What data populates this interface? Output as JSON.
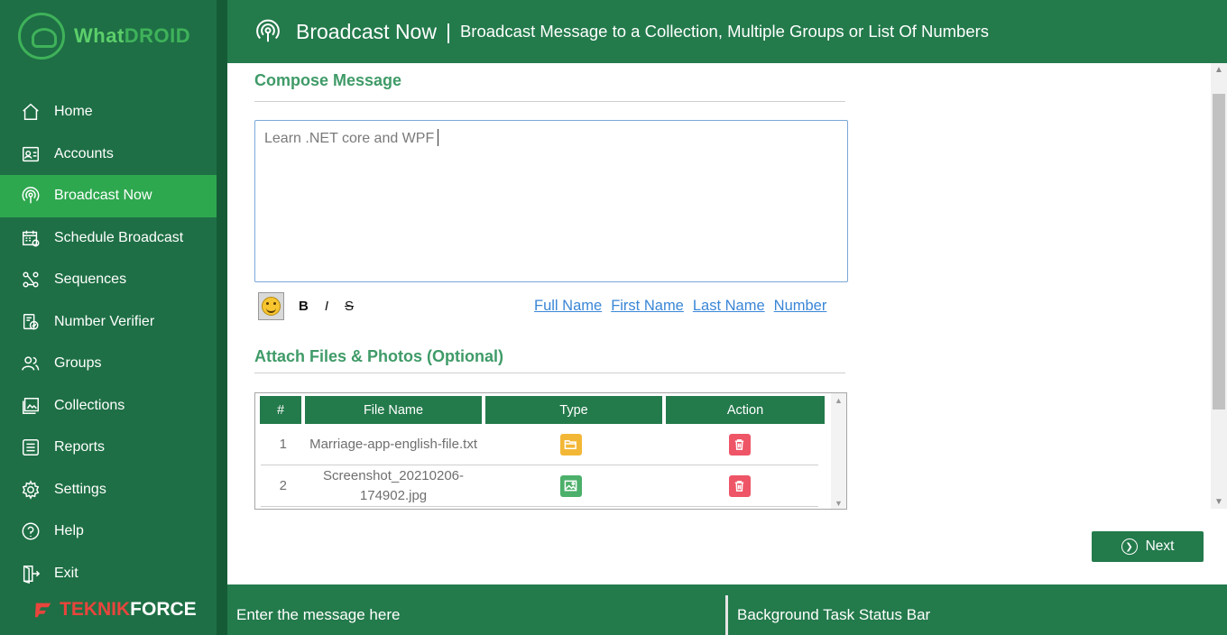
{
  "app": {
    "logo": {
      "part1": "What",
      "part2": "DROID"
    },
    "brand": {
      "part1": "TEKNIK",
      "part2": "FORCE"
    }
  },
  "sidebar": {
    "items": [
      {
        "label": "Home",
        "icon": "home-icon"
      },
      {
        "label": "Accounts",
        "icon": "accounts-icon"
      },
      {
        "label": "Broadcast Now",
        "icon": "broadcast-icon",
        "active": true
      },
      {
        "label": "Schedule Broadcast",
        "icon": "calendar-icon"
      },
      {
        "label": "Sequences",
        "icon": "sequences-icon"
      },
      {
        "label": "Number Verifier",
        "icon": "verifier-icon"
      },
      {
        "label": "Groups",
        "icon": "groups-icon"
      },
      {
        "label": "Collections",
        "icon": "collections-icon"
      },
      {
        "label": "Reports",
        "icon": "reports-icon"
      },
      {
        "label": "Settings",
        "icon": "gear-icon"
      },
      {
        "label": "Help",
        "icon": "help-icon"
      },
      {
        "label": "Exit",
        "icon": "exit-icon"
      }
    ]
  },
  "header": {
    "title": "Broadcast Now",
    "separator": "|",
    "subtitle": "Broadcast Message to a Collection, Multiple Groups or List Of Numbers"
  },
  "compose": {
    "title": "Compose Message",
    "message": "Learn .NET core and WPF",
    "format": {
      "bold": "B",
      "italic": "I",
      "strike": "S"
    },
    "merge_fields": [
      "Full Name",
      "First Name",
      "Last Name",
      "Number"
    ]
  },
  "attach": {
    "title": "Attach Files & Photos (Optional)",
    "columns": [
      "#",
      "File Name",
      "Type",
      "Action"
    ],
    "rows": [
      {
        "num": "1",
        "name": "Marriage-app-english-file.txt",
        "type": "folder-icon"
      },
      {
        "num": "2",
        "name": "Screenshot_20210206-174902.jpg",
        "type": "image-icon"
      }
    ]
  },
  "next_label": "Next",
  "status": {
    "left": "Enter the message here",
    "right": "Background Task Status Bar"
  },
  "colors": {
    "sidebar": "#1e6f45",
    "active": "#2ea84f",
    "header": "#237a4b",
    "section_title": "#3f9b68",
    "link": "#3a86d6",
    "delete": "#ee5566",
    "folder": "#f3b737",
    "image": "#4caf6a"
  }
}
